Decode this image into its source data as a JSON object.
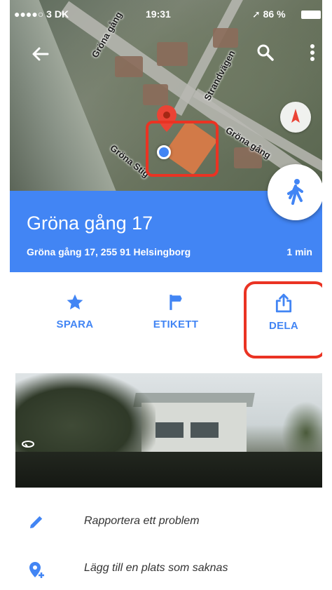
{
  "status_bar": {
    "carrier": "●●●●○ 3 DK",
    "time": "19:31",
    "battery": "86 %"
  },
  "map": {
    "street_labels": [
      "Gröna gång",
      "Strandvägen",
      "Gröna gång",
      "Gröna Stig"
    ]
  },
  "place": {
    "title": "Gröna gång 17",
    "address": "Gröna gång 17, 255 91 Helsingborg",
    "travel_time": "1 min"
  },
  "actions": [
    {
      "label": "SPARA",
      "icon": "star-icon"
    },
    {
      "label": "ETIKETT",
      "icon": "flag-icon"
    },
    {
      "label": "DELA",
      "icon": "share-icon"
    }
  ],
  "list": [
    {
      "label": "Rapportera ett problem",
      "icon": "pencil-icon"
    },
    {
      "label": "Lägg till en plats som saknas",
      "icon": "add-place-icon"
    }
  ],
  "colors": {
    "accent": "#4285f4",
    "highlight": "#ea3323",
    "pin": "#ea4335"
  }
}
